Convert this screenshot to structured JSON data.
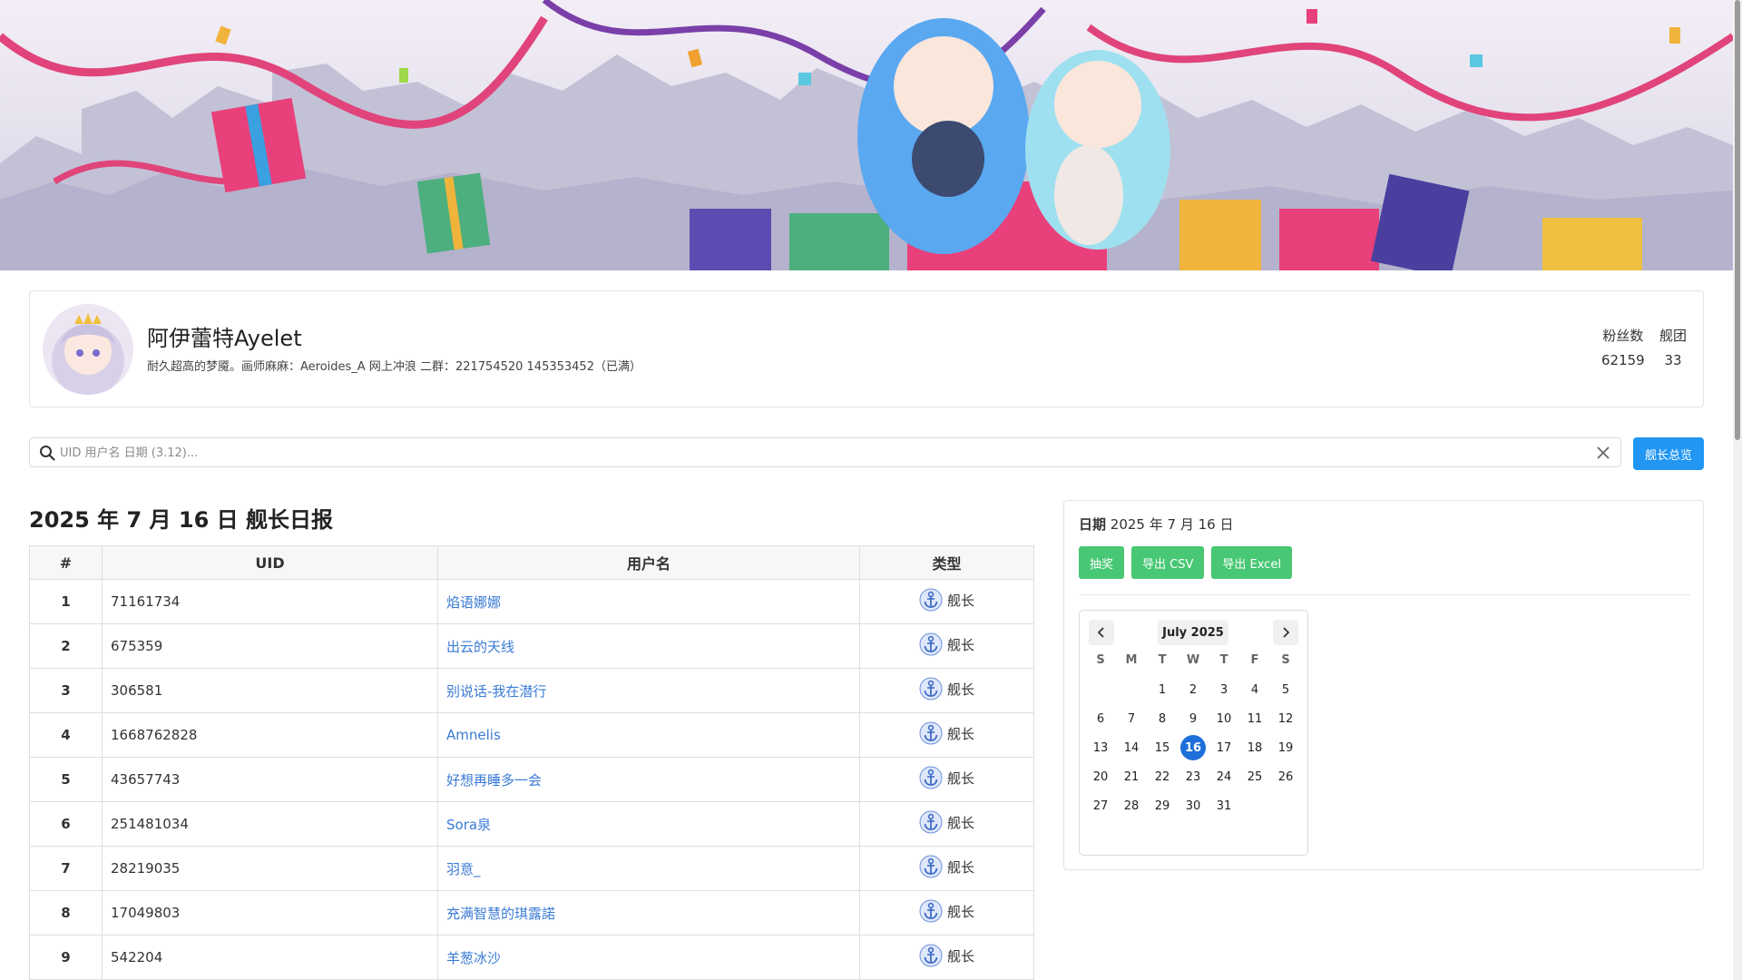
{
  "profile": {
    "name": "阿伊蕾特Ayelet",
    "description": "耐久超高的梦魇。画师麻麻：Aeroides_A 网上冲浪 二群：221754520 145353452（已满）",
    "stats": [
      {
        "label": "粉丝数",
        "value": "62159"
      },
      {
        "label": "舰团",
        "value": "33"
      }
    ]
  },
  "search": {
    "placeholder": "UID 用户名 日期 (3.12)...",
    "value": ""
  },
  "overview_button": "舰长总览",
  "report_title": "2025 年 7 月 16 日 舰长日报",
  "table": {
    "headers": [
      "#",
      "UID",
      "用户名",
      "类型"
    ],
    "rows": [
      {
        "num": "1",
        "uid": "71161734",
        "user": "焰语娜娜",
        "type": "舰长"
      },
      {
        "num": "2",
        "uid": "675359",
        "user": "出云的天线",
        "type": "舰长"
      },
      {
        "num": "3",
        "uid": "306581",
        "user": "别说话-我在潜行",
        "type": "舰长"
      },
      {
        "num": "4",
        "uid": "1668762828",
        "user": "Amnelis",
        "type": "舰长"
      },
      {
        "num": "5",
        "uid": "43657743",
        "user": "好想再睡多一会",
        "type": "舰长"
      },
      {
        "num": "6",
        "uid": "251481034",
        "user": "Sora泉",
        "type": "舰长"
      },
      {
        "num": "7",
        "uid": "28219035",
        "user": "羽意_",
        "type": "舰长"
      },
      {
        "num": "8",
        "uid": "17049803",
        "user": "充满智慧的琪露諾",
        "type": "舰长"
      },
      {
        "num": "9",
        "uid": "542204",
        "user": "羊葱冰沙",
        "type": "舰长"
      }
    ]
  },
  "panel": {
    "date_label": "日期",
    "date_value": "2025 年 7 月 16 日",
    "buttons": [
      "抽奖",
      "导出 CSV",
      "导出 Excel"
    ],
    "calendar": {
      "month_label": "July 2025",
      "weekdays": [
        "S",
        "M",
        "T",
        "W",
        "T",
        "F",
        "S"
      ],
      "first_weekday": 2,
      "days_in_month": 31,
      "selected_day": 16
    }
  },
  "colors": {
    "primary_blue": "#2196f3",
    "success_green": "#48c774",
    "link_blue": "#3a7bd5",
    "selected_day": "#1e6fd9"
  }
}
